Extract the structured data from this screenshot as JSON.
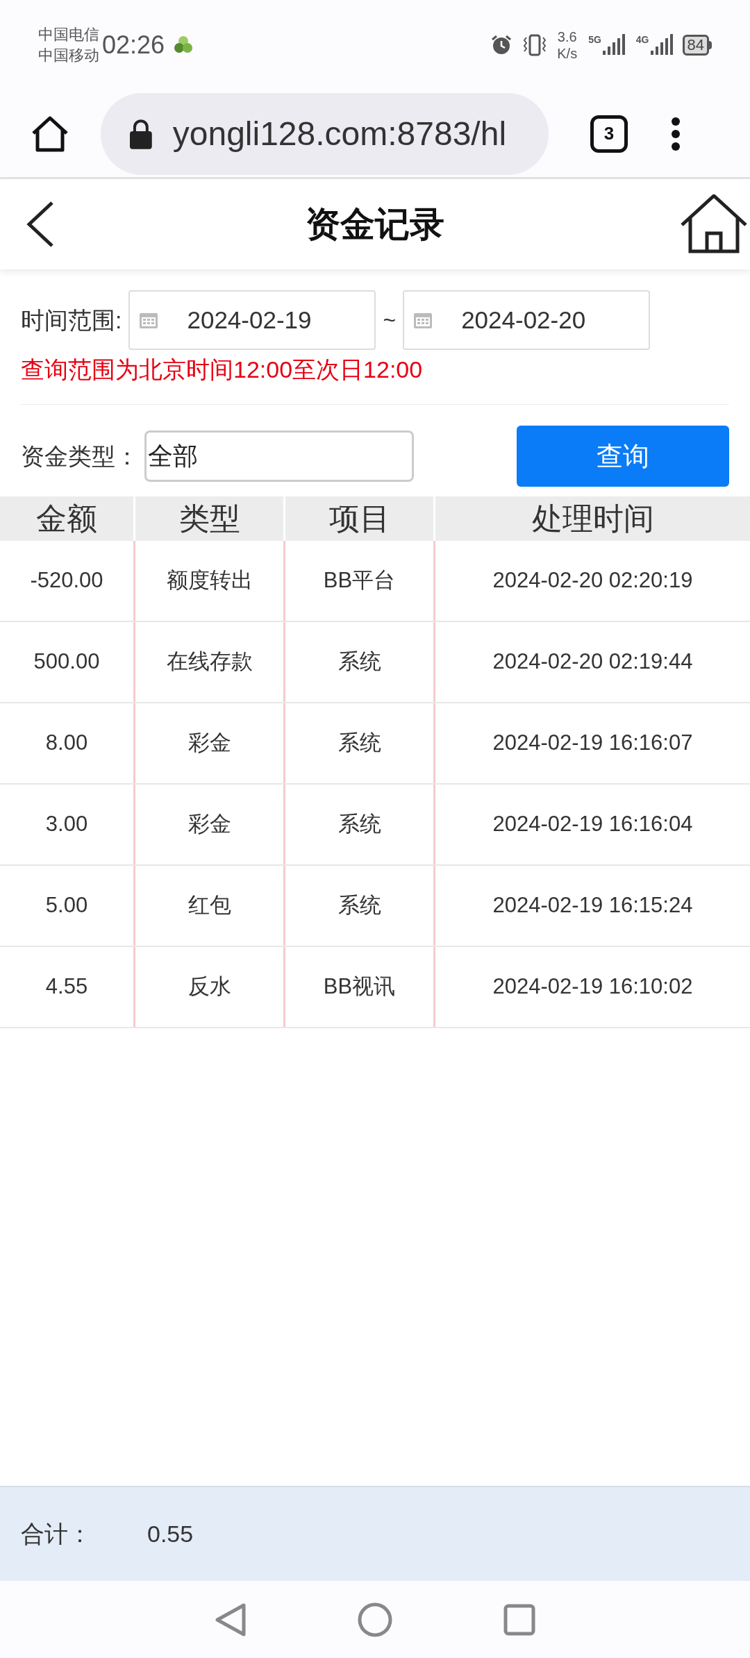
{
  "status_bar": {
    "carriers": [
      "中国电信",
      "中国移动"
    ],
    "time": "02:26",
    "speed": [
      "3.6",
      "K/s"
    ],
    "network_1": "5G",
    "network_2": "4G",
    "battery": "84"
  },
  "browser": {
    "url": "yongli128.com:8783/hl",
    "tab_count": "3"
  },
  "header": {
    "title": "资金记录"
  },
  "filters": {
    "date_label": "时间范围:",
    "date_from": "2024-02-19",
    "separator": "~",
    "date_to": "2024-02-20",
    "note": "查询范围为北京时间12:00至次日12:00",
    "type_label": "资金类型：",
    "type_value": "全部",
    "search_button": "查询"
  },
  "table": {
    "columns": [
      "金额",
      "类型",
      "项目",
      "处理时间"
    ],
    "rows": [
      [
        "-520.00",
        "额度转出",
        "BB平台",
        "2024-02-20 02:20:19"
      ],
      [
        "500.00",
        "在线存款",
        "系统",
        "2024-02-20 02:19:44"
      ],
      [
        "8.00",
        "彩金",
        "系统",
        "2024-02-19 16:16:07"
      ],
      [
        "3.00",
        "彩金",
        "系统",
        "2024-02-19 16:16:04"
      ],
      [
        "5.00",
        "红包",
        "系统",
        "2024-02-19 16:15:24"
      ],
      [
        "4.55",
        "反水",
        "BB视讯",
        "2024-02-19 16:10:02"
      ]
    ]
  },
  "footer": {
    "label": "合计：",
    "total": "0.55"
  }
}
